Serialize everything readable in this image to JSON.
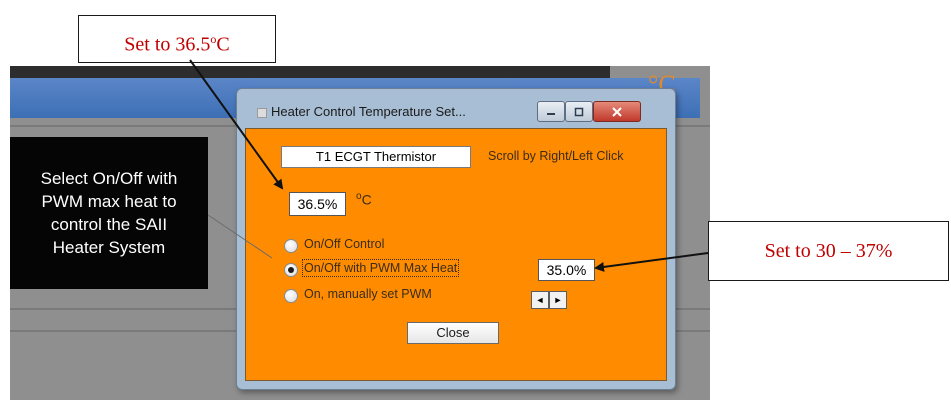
{
  "callouts": {
    "top": {
      "text": "Set to 36.5",
      "superscript": "o",
      "unit": "C"
    },
    "right": {
      "text": "Set to 30 – 37%"
    },
    "left": {
      "text": "Select On/Off with PWM max heat to control the SAII Heater System"
    }
  },
  "background": {
    "degc_text": "°C"
  },
  "dialog": {
    "title": "Heater Control Temperature Set...",
    "window_buttons": {
      "minimize": "–",
      "maximize": "□",
      "close": "✕"
    },
    "sensor_label": "T1  ECGT Thermistor",
    "scroll_hint": "Scroll by Right/Left Click",
    "temperature_value": "36.5%",
    "unit_superscript": "o",
    "unit_letter": "C",
    "modes": [
      {
        "label": "On/Off Control",
        "selected": false
      },
      {
        "label": "On/Off with PWM Max Heat",
        "selected": true
      },
      {
        "label": "On, manually set PWM",
        "selected": false
      }
    ],
    "pwm_value": "35.0%",
    "arrows": {
      "left": "◄",
      "right": "►"
    },
    "close_label": "Close"
  },
  "colors": {
    "dialog_client": "#ff8c00",
    "callout_text": "#c00000",
    "left_callout_bg": "#050505",
    "app_title_blue": "#4a7bbf"
  },
  "icons": [
    "app-icon",
    "minimize-icon",
    "maximize-icon",
    "close-icon",
    "left-arrow-icon",
    "right-arrow-icon"
  ]
}
